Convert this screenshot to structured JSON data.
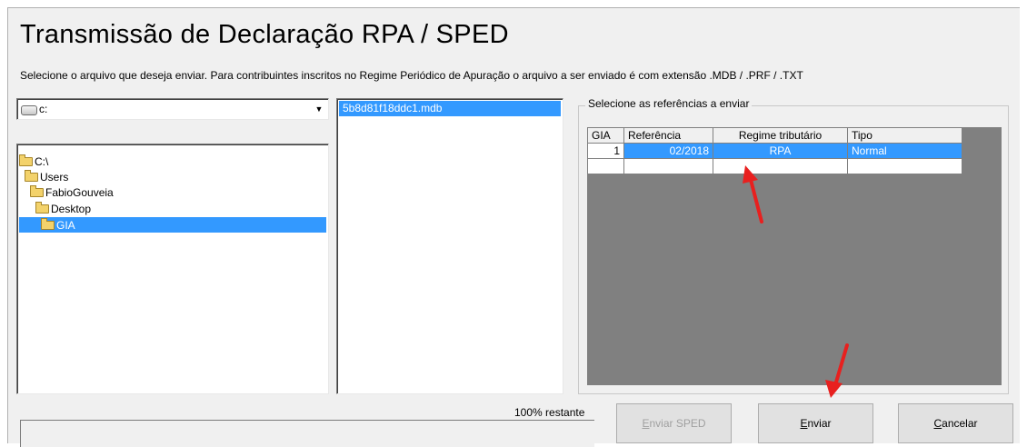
{
  "header": {
    "title": "Transmissão de Declaração RPA / SPED",
    "subtitle": "Selecione o arquivo que deseja enviar. Para contribuintes inscritos no Regime Periódico de Apuração o arquivo a ser enviado é com extensão .MDB / .PRF / .TXT"
  },
  "drive": {
    "value": "c:"
  },
  "folders": [
    {
      "label": "C:\\",
      "selected": false
    },
    {
      "label": "Users",
      "selected": false
    },
    {
      "label": "FabioGouveia",
      "selected": false
    },
    {
      "label": "Desktop",
      "selected": false
    },
    {
      "label": "GIA",
      "selected": true
    }
  ],
  "files": [
    "5b8d81f18ddc1.mdb"
  ],
  "references": {
    "label": "Selecione as referências a enviar",
    "columns": [
      "GIA",
      "Referência",
      "Regime tributário",
      "Tipo"
    ],
    "rows": [
      {
        "gia": "1",
        "referencia": "02/2018",
        "regime": "RPA",
        "tipo": "Normal"
      }
    ]
  },
  "status": {
    "text": "100% restante"
  },
  "buttons": {
    "enviar_sped": "Enviar SPED",
    "enviar": "Enviar",
    "cancelar": "Cancelar"
  },
  "annotation_color": "#e8201f"
}
